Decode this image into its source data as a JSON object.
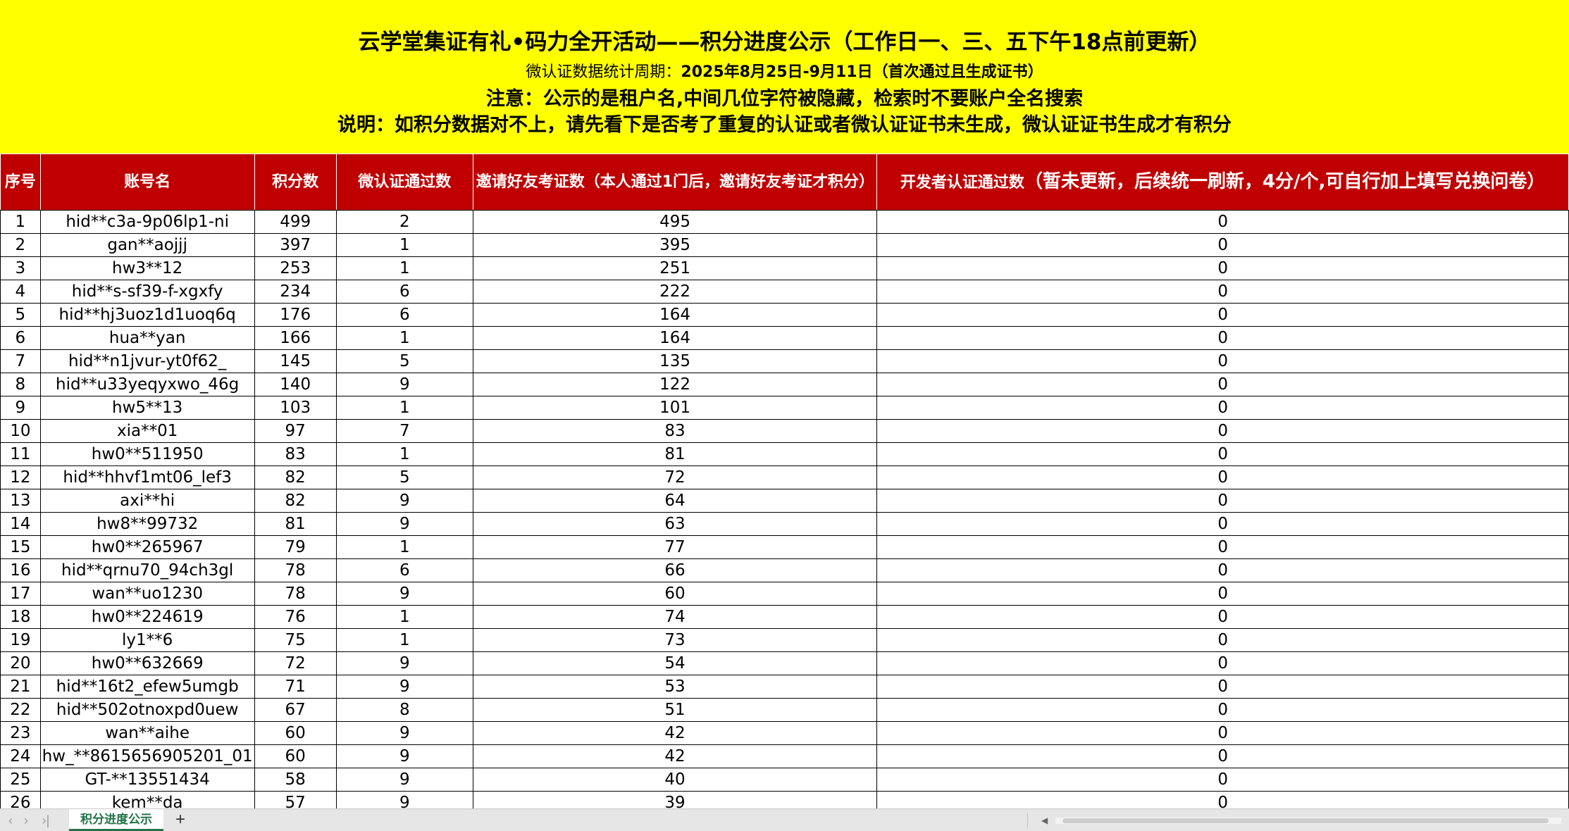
{
  "banner": {
    "title": "云学堂集证有礼•码力全开活动——积分进度公示（工作日一、三、五下午18点前更新）",
    "period_label": "微认证数据统计周期：",
    "period_value": "2025年8月25日-9月11日（首次通过且生成证书）",
    "notice": "注意：公示的是租户名,中间几位字符被隐藏，检索时不要账户全名搜索",
    "explain": "说明：如积分数据对不上，请先看下是否考了重复的认证或者微认证证书未生成，微认证证书生成才有积分"
  },
  "table": {
    "headers": {
      "seq": "序号",
      "account": "账号名",
      "points": "积分数",
      "micro_cert": "微认证通过数",
      "invite": "邀请好友考证数（本人通过1门后，邀请好友考证才积分）",
      "dev_main": "开发者认证通过数",
      "dev_note": "（暂未更新，后续统一刷新，4分/个,可自行加上填写兑换问卷）"
    },
    "rows": [
      {
        "seq": "1",
        "account": "hid**c3a-9p06lp1-ni",
        "points": "499",
        "micro": "2",
        "invite": "495",
        "dev": "0"
      },
      {
        "seq": "2",
        "account": "gan**aojjj",
        "points": "397",
        "micro": "1",
        "invite": "395",
        "dev": "0"
      },
      {
        "seq": "3",
        "account": "hw3**12",
        "points": "253",
        "micro": "1",
        "invite": "251",
        "dev": "0"
      },
      {
        "seq": "4",
        "account": "hid**s-sf39-f-xgxfy",
        "points": "234",
        "micro": "6",
        "invite": "222",
        "dev": "0"
      },
      {
        "seq": "5",
        "account": "hid**hj3uoz1d1uoq6q",
        "points": "176",
        "micro": "6",
        "invite": "164",
        "dev": "0"
      },
      {
        "seq": "6",
        "account": "hua**yan",
        "points": "166",
        "micro": "1",
        "invite": "164",
        "dev": "0"
      },
      {
        "seq": "7",
        "account": "hid**n1jvur-yt0f62_",
        "points": "145",
        "micro": "5",
        "invite": "135",
        "dev": "0"
      },
      {
        "seq": "8",
        "account": "hid**u33yeqyxwo_46g",
        "points": "140",
        "micro": "9",
        "invite": "122",
        "dev": "0"
      },
      {
        "seq": "9",
        "account": "hw5**13",
        "points": "103",
        "micro": "1",
        "invite": "101",
        "dev": "0"
      },
      {
        "seq": "10",
        "account": "xia**01",
        "points": "97",
        "micro": "7",
        "invite": "83",
        "dev": "0"
      },
      {
        "seq": "11",
        "account": "hw0**511950",
        "points": "83",
        "micro": "1",
        "invite": "81",
        "dev": "0"
      },
      {
        "seq": "12",
        "account": "hid**hhvf1mt06_lef3",
        "points": "82",
        "micro": "5",
        "invite": "72",
        "dev": "0"
      },
      {
        "seq": "13",
        "account": "axi**hi",
        "points": "82",
        "micro": "9",
        "invite": "64",
        "dev": "0"
      },
      {
        "seq": "14",
        "account": "hw8**99732",
        "points": "81",
        "micro": "9",
        "invite": "63",
        "dev": "0"
      },
      {
        "seq": "15",
        "account": "hw0**265967",
        "points": "79",
        "micro": "1",
        "invite": "77",
        "dev": "0"
      },
      {
        "seq": "16",
        "account": "hid**qrnu70_94ch3gl",
        "points": "78",
        "micro": "6",
        "invite": "66",
        "dev": "0"
      },
      {
        "seq": "17",
        "account": "wan**uo1230",
        "points": "78",
        "micro": "9",
        "invite": "60",
        "dev": "0"
      },
      {
        "seq": "18",
        "account": "hw0**224619",
        "points": "76",
        "micro": "1",
        "invite": "74",
        "dev": "0"
      },
      {
        "seq": "19",
        "account": "ly1**6",
        "points": "75",
        "micro": "1",
        "invite": "73",
        "dev": "0"
      },
      {
        "seq": "20",
        "account": "hw0**632669",
        "points": "72",
        "micro": "9",
        "invite": "54",
        "dev": "0"
      },
      {
        "seq": "21",
        "account": "hid**16t2_efew5umgb",
        "points": "71",
        "micro": "9",
        "invite": "53",
        "dev": "0"
      },
      {
        "seq": "22",
        "account": "hid**502otnoxpd0uew",
        "points": "67",
        "micro": "8",
        "invite": "51",
        "dev": "0"
      },
      {
        "seq": "23",
        "account": "wan**aihe",
        "points": "60",
        "micro": "9",
        "invite": "42",
        "dev": "0"
      },
      {
        "seq": "24",
        "account": "hw_**8615656905201_01",
        "points": "60",
        "micro": "9",
        "invite": "42",
        "dev": "0"
      },
      {
        "seq": "25",
        "account": "GT-**13551434",
        "points": "58",
        "micro": "9",
        "invite": "40",
        "dev": "0"
      },
      {
        "seq": "26",
        "account": "kem**da",
        "points": "57",
        "micro": "9",
        "invite": "39",
        "dev": "0"
      }
    ]
  },
  "tabbar": {
    "nav_first_icon": "chevron-left-icon",
    "nav_prev_icon": "chevron-right-icon",
    "nav_last_icon": "last-sheet-icon",
    "sheet_tab": "积分进度公示",
    "add_sheet": "+"
  },
  "colors": {
    "banner_bg": "#ffff00",
    "header_bg": "#c00000",
    "tab_accent": "#217346"
  }
}
